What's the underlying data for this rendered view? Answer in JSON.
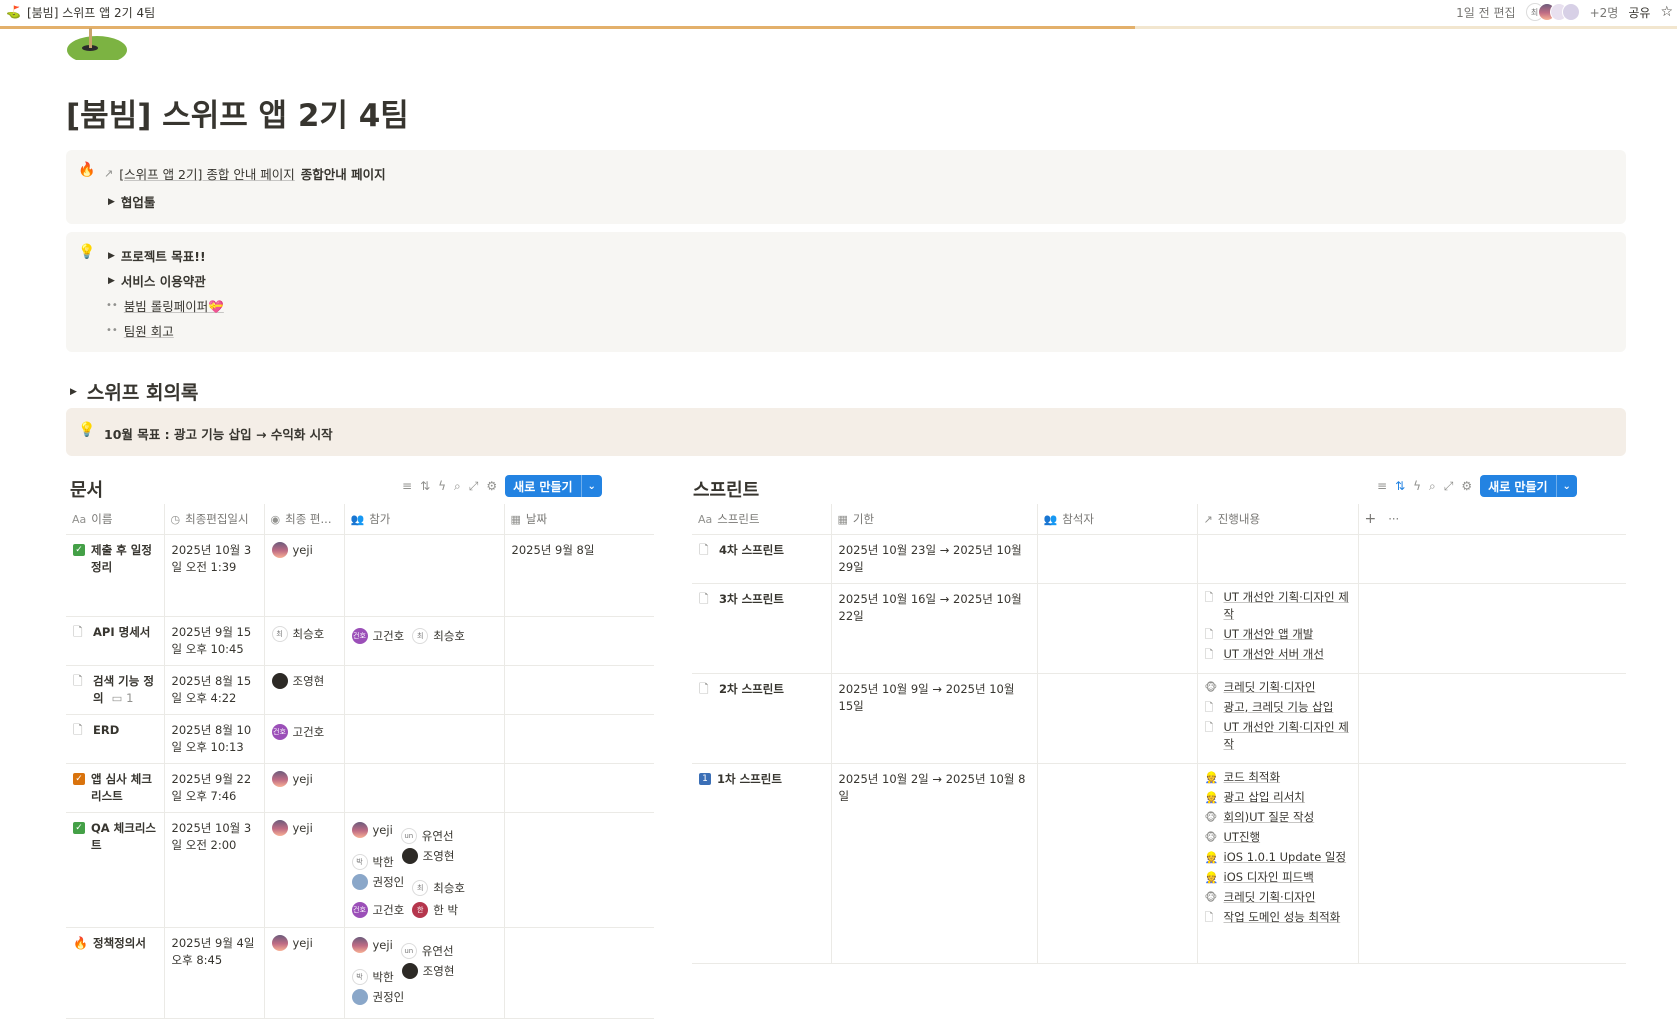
{
  "topbar": {
    "breadcrumb_title": "[붐빔] 스위프 앱 2기 4팀",
    "edited": "1일 전 편집",
    "avatar_initial": "최",
    "extra_count": "+2명",
    "share": "공유"
  },
  "progress_pct": 67.7,
  "page": {
    "title": "[붐빔] 스위프 앱 2기 4팀"
  },
  "callout1": {
    "link_text": "[스위프 앱 2기] 종합 안내 페이지",
    "link_suffix": "종합안내 페이지",
    "toggle1": "협업툴"
  },
  "callout2": {
    "items": [
      "프로젝트 목표!!",
      "서비스 이용약관"
    ],
    "links": [
      "붐빔 롤링페이퍼💝",
      "팀원 회고"
    ]
  },
  "heading": "스위프 회의록",
  "goal_callout": "10월 목표 : 광고 기능 삽입 → 수익화 시작",
  "docs": {
    "title": "문서",
    "new_label": "새로 만들기",
    "columns": [
      "이름",
      "최종편집일시",
      "최종 편...",
      "참가",
      "날짜"
    ],
    "rows": [
      {
        "name": "제출 후 일정 정리",
        "edited": "2025년 10월 3일 오전 1:39",
        "editor": "yeji",
        "participants": [],
        "date": "2025년 9월 8일"
      },
      {
        "name": "API 명세서",
        "edited": "2025년 9월 15일 오후 10:45",
        "editor": "최승호",
        "participants": [
          "고건호",
          "최승호"
        ],
        "date": ""
      },
      {
        "name": "검색 기능 정의",
        "comments": "1",
        "edited": "2025년 8월 15일 오후 4:22",
        "editor": "조영현",
        "participants": [],
        "date": ""
      },
      {
        "name": "ERD",
        "edited": "2025년 8월 10일 오후 10:13",
        "editor": "고건호",
        "participants": [],
        "date": ""
      },
      {
        "name": "앱 심사 체크리스트",
        "edited": "2025년 9월 22일 오후 7:46",
        "editor": "yeji",
        "participants": [],
        "date": ""
      },
      {
        "name": "QA 체크리스트",
        "edited": "2025년 10월 3일 오전 2:00",
        "editor": "yeji",
        "participants": [
          "yeji",
          "유연선",
          "박한",
          "조영현",
          "권정인",
          "최승호",
          "고건호",
          "한 박"
        ],
        "date": ""
      },
      {
        "name": "정책정의서",
        "edited": "2025년 9월 4일 오후 8:45",
        "editor": "yeji",
        "participants": [
          "yeji",
          "유연선",
          "박한",
          "조영현",
          "권정인"
        ],
        "date": ""
      }
    ]
  },
  "sprints": {
    "title": "스프린트",
    "new_label": "새로 만들기",
    "columns": [
      "스프린트",
      "기한",
      "참석자",
      "진행내용"
    ],
    "rows": [
      {
        "name": "4차 스프린트",
        "period": "2025년 10월 23일 → 2025년 10월 29일",
        "items": []
      },
      {
        "name": "3차 스프린트",
        "period": "2025년 10월 16일 → 2025년 10월 22일",
        "items": [
          "UT 개선안 기획·디자인 제작",
          "UT 개선안 앱 개발",
          "UT 개선안 서버 개선"
        ]
      },
      {
        "name": "2차 스프린트",
        "period": "2025년 10월 9일 → 2025년 10월 15일",
        "items": [
          "크레딧 기획·디자인",
          "광고, 크레딧 기능 삽입",
          "UT 개선안 기획·디자인 제작"
        ]
      },
      {
        "name": "1차 스프린트",
        "period": "2025년 10월 2일 → 2025년 10월 8일",
        "items": [
          "코드 최적화",
          "광고 삽입 리서치",
          "회의)UT 질문 작성",
          "UT진행",
          "iOS 1.0.1 Update 일정",
          "iOS 디자인 피드백",
          "크레딧 기획·디자인",
          "작업 도메인 성능 최적화"
        ]
      }
    ]
  }
}
